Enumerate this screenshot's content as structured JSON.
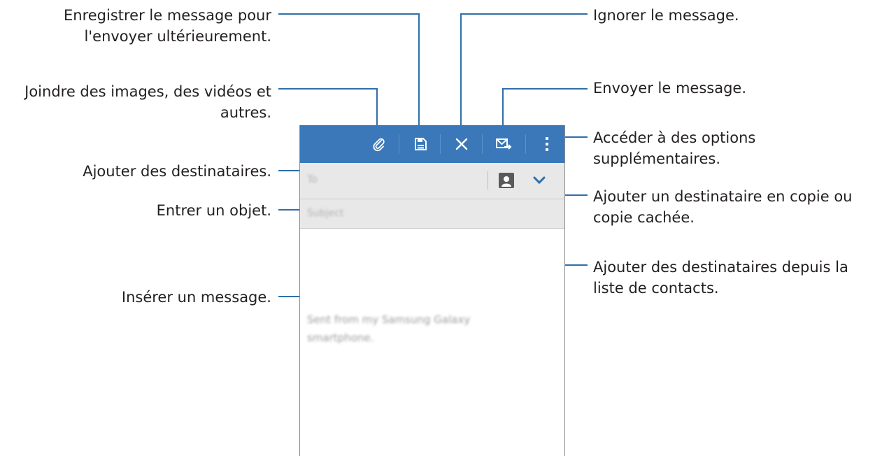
{
  "callouts": {
    "save_draft": "Enregistrer le message pour\nl'envoyer ultérieurement.",
    "attach": "Joindre des images, des vidéos et\nautres.",
    "add_recipients": "Ajouter des destinataires.",
    "subject": "Entrer un objet.",
    "message": "Insérer un message.",
    "discard": "Ignorer le message.",
    "send": "Envoyer le message.",
    "more_options": "Accéder à des options\nsupplémentaires.",
    "cc_bcc": "Ajouter un destinataire en copie ou\ncopie cachée.",
    "contacts": "Ajouter des destinataires depuis la\nliste de contacts."
  },
  "phone": {
    "to_placeholder": "To",
    "subject_placeholder": "Subject",
    "signature": "Sent from my Samsung Galaxy\nsmartphone."
  },
  "icons": {
    "attach": "paperclip-icon",
    "save": "save-icon",
    "discard": "close-icon",
    "send": "send-mail-icon",
    "more": "more-vert-icon",
    "contacts": "contact-icon",
    "expand": "chevron-down-icon"
  },
  "colors": {
    "action_bar": "#3a78b9",
    "callout_line": "#2f6fa8",
    "field_bg": "#e8e8e8"
  }
}
